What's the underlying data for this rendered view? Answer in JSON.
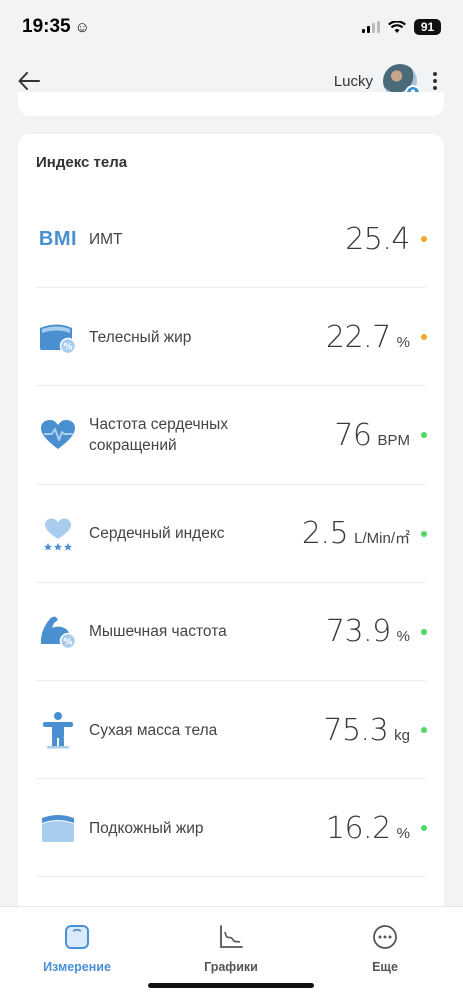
{
  "status_bar": {
    "time": "19:35",
    "battery": "91"
  },
  "header": {
    "user_name": "Lucky"
  },
  "section": {
    "title": "Индекс тела",
    "metrics": [
      {
        "icon": "bmi-icon",
        "icon_text": "BMI",
        "label": "ИМТ",
        "value": "25.4",
        "unit": "",
        "status_color": "#f5a623"
      },
      {
        "icon": "body-fat-icon",
        "label": "Телесный жир",
        "value": "22.7",
        "unit": "%",
        "status_color": "#f5a623"
      },
      {
        "icon": "heart-rate-icon",
        "label": "Частота сердечных сокращений",
        "value": "76",
        "unit": "BPM",
        "status_color": "#4cd964"
      },
      {
        "icon": "cardiac-index-icon",
        "label": "Сердечный индекс",
        "value": "2.5",
        "unit": "L/Min/㎡",
        "status_color": "#4cd964"
      },
      {
        "icon": "muscle-icon",
        "label": "Мышечная частота",
        "value": "73.9",
        "unit": "%",
        "status_color": "#4cd964"
      },
      {
        "icon": "lean-body-mass-icon",
        "label": "Сухая масса тела",
        "value": "75.3",
        "unit": "kg",
        "status_color": "#4cd964"
      },
      {
        "icon": "subcutaneous-fat-icon",
        "label": "Подкожный жир",
        "value": "16.2",
        "unit": "%",
        "status_color": "#4cd964"
      }
    ]
  },
  "nav": {
    "items": [
      {
        "label": "Измерение",
        "icon": "scale-icon",
        "active": true
      },
      {
        "label": "Графики",
        "icon": "chart-icon",
        "active": false
      },
      {
        "label": "Еще",
        "icon": "more-circle-icon",
        "active": false
      }
    ]
  },
  "colors": {
    "accent": "#4a90d9",
    "icon_blue": "#4a8fd0",
    "inactive": "#555555"
  }
}
